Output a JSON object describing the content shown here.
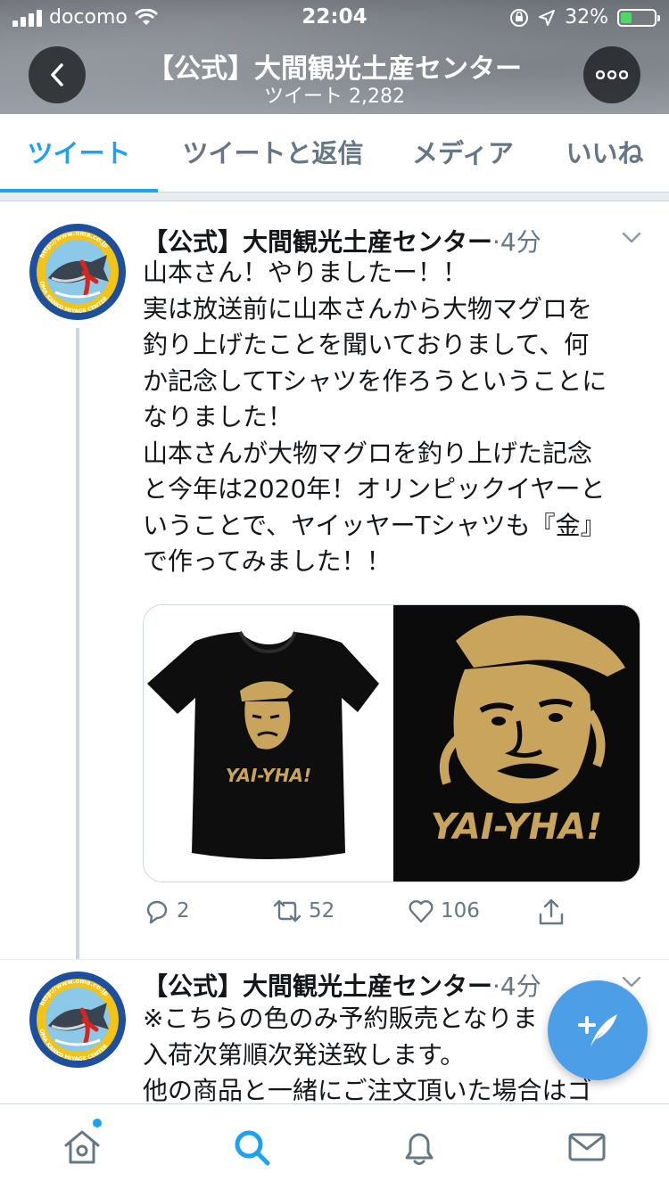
{
  "status_bar": {
    "carrier": "docomo",
    "time": "22:04",
    "battery": "32%",
    "battery_level": 0.32
  },
  "header": {
    "title": "【公式】大間観光土産センター",
    "subtitle": "ツイート 2,282"
  },
  "tabs": [
    {
      "label": "ツイート",
      "active": true
    },
    {
      "label": "ツイートと返信",
      "active": false
    },
    {
      "label": "メディア",
      "active": false
    },
    {
      "label": "いいね",
      "active": false
    }
  ],
  "tweets": [
    {
      "name": "【公式】大間観光土産センター",
      "dot": "·",
      "time": "4分",
      "lines": [
        "山本さん！やりましたー！！",
        "実は放送前に山本さんから大物マグロを",
        "釣り上げたことを聞いておりまして、何",
        "か記念してTシャツを作ろうということに",
        "なりました！",
        "山本さんが大物マグロを釣り上げた記念",
        "と今年は2020年！オリンピックイヤーと",
        "いうことで、ヤイッヤーTシャツも『金』",
        "で作ってみました！！"
      ],
      "media_text": "YAI-YHA!",
      "replies": "2",
      "retweets": "52",
      "likes": "106"
    },
    {
      "name": "【公式】大間観光土産センター",
      "dot": "·",
      "time": "4分",
      "lines": [
        "※こちらの色のみ予約販売となりま",
        "入荷次第順次発送致します。",
        "他の商品と一緒にご注文頂いた場合はゴ"
      ]
    }
  ],
  "avatar": {
    "ring_text": "http://www.oma.co.jp",
    "bottom_text": "OMA KANKO MIYAGE CENTER"
  },
  "colors": {
    "accent": "#1da1f2",
    "fab": "#4c9fe7",
    "muted": "#657786",
    "shirt_gold": "#c9a45c"
  },
  "icons": [
    "back-icon",
    "more-icon",
    "chevron-down-icon",
    "reply-icon",
    "retweet-icon",
    "like-icon",
    "share-icon",
    "compose-icon",
    "home-icon",
    "search-icon",
    "notifications-icon",
    "messages-icon"
  ]
}
